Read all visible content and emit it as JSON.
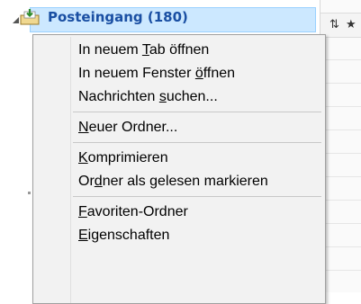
{
  "folder_tree": {
    "selected_folder": {
      "label": "Posteingang (180)",
      "icon": "inbox-icon"
    }
  },
  "context_menu": {
    "groups": [
      [
        {
          "label": "In neuem Tab öffnen",
          "mnemonic": "T"
        },
        {
          "label": "In neuem Fenster öffnen",
          "mnemonic": "ö"
        },
        {
          "label": "Nachrichten suchen...",
          "mnemonic": "s"
        }
      ],
      [
        {
          "label": "Neuer Ordner...",
          "mnemonic": "N"
        }
      ],
      [
        {
          "label": "Komprimieren",
          "mnemonic": "K"
        },
        {
          "label": "Ordner als gelesen markieren",
          "mnemonic": "d"
        }
      ],
      [
        {
          "label": "Favoriten-Ordner",
          "mnemonic": "F"
        },
        {
          "label": "Eigenschaften",
          "mnemonic": "E"
        }
      ]
    ]
  },
  "colors": {
    "selection_bg": "#cce8ff",
    "selection_border": "#99d1ff",
    "menu_bg": "#f2f2f2",
    "folder_label": "#1a4fa3"
  }
}
